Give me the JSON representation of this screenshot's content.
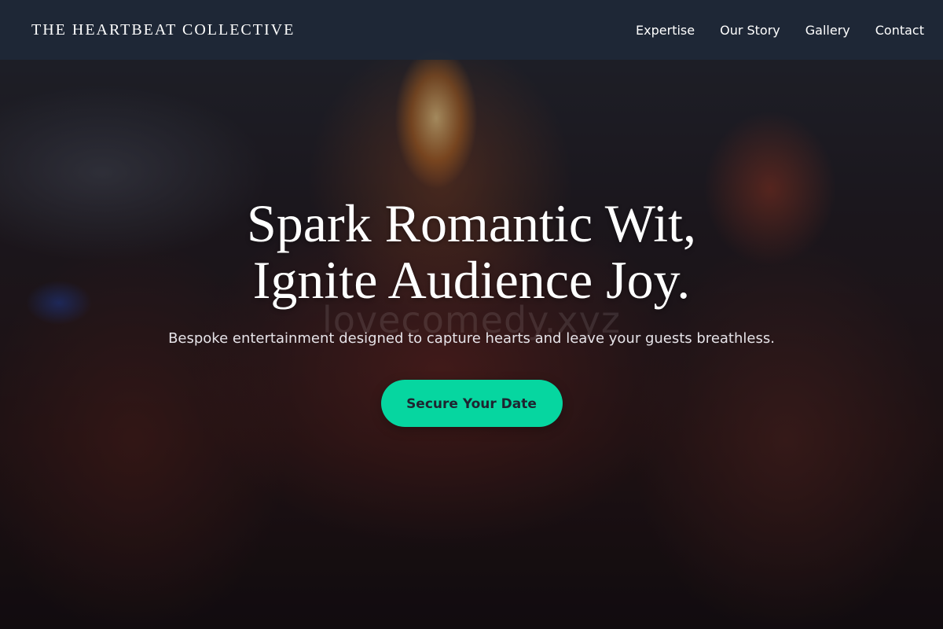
{
  "header": {
    "brand": "THE HEARTBEAT COLLECTIVE",
    "nav": [
      {
        "label": "Expertise"
      },
      {
        "label": "Our Story"
      },
      {
        "label": "Gallery"
      },
      {
        "label": "Contact"
      }
    ]
  },
  "hero": {
    "headline_line1": "Spark Romantic Wit,",
    "headline_line2": "Ignite Audience Joy.",
    "subtitle": "Bespoke entertainment designed to capture hearts and leave your guests breathless.",
    "cta_label": "Secure Your Date",
    "watermark": "lovecomedy.xyz"
  },
  "colors": {
    "accent": "#06d6a0",
    "header_bg": "#1e2837",
    "text": "#ffffff"
  }
}
